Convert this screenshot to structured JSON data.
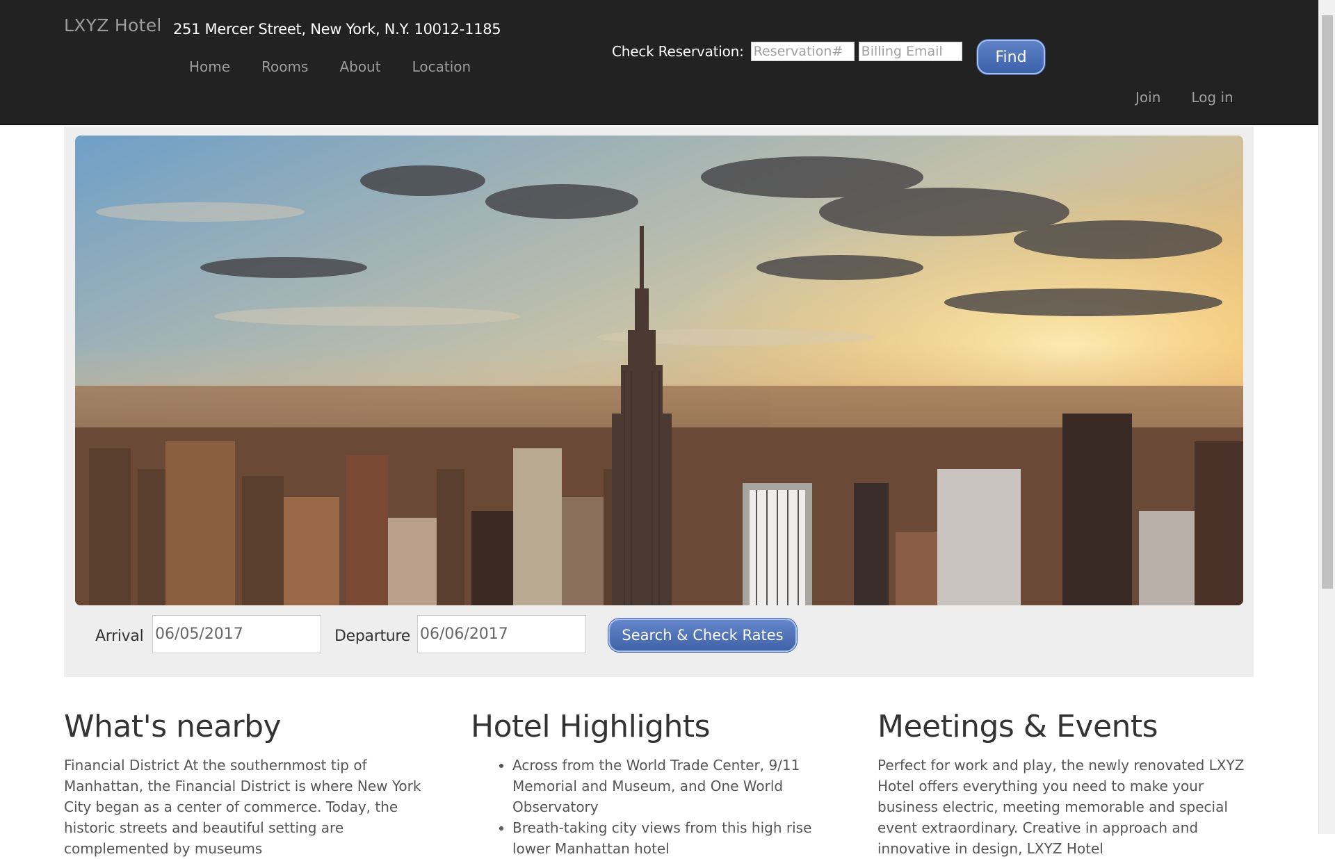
{
  "navbar": {
    "brand": "LXYZ Hotel",
    "address": "251 Mercer Street, New York, N.Y. 10012-1185",
    "links": [
      "Home",
      "Rooms",
      "About",
      "Location"
    ],
    "check_reservation": {
      "label": "Check Reservation:",
      "reservation_placeholder": "Reservation#",
      "email_placeholder": "Billing Email",
      "find_label": "Find"
    },
    "auth": {
      "join": "Join",
      "login": "Log in"
    }
  },
  "booking": {
    "arrival_label": "Arrival",
    "arrival_value": "06/05/2017",
    "departure_label": "Departure",
    "departure_value": "06/06/2017",
    "search_label": "Search & Check Rates"
  },
  "columns": {
    "nearby": {
      "title": "What's nearby",
      "text": "Financial District At the southernmost tip of Manhattan, the Financial District is where New York City began as a center of commerce. Today, the historic streets and beautiful setting are complemented by museums"
    },
    "highlights": {
      "title": "Hotel Highlights",
      "items": [
        "Across from the World Trade Center, 9/11 Memorial and Museum, and One World Observatory",
        "Breath-taking city views from this high rise lower Manhattan hotel"
      ]
    },
    "meetings": {
      "title": "Meetings & Events",
      "text": "Perfect for work and play, the newly renovated LXYZ Hotel offers everything you need to make your business electric, meeting memorable and special event extraordinary. Creative in approach and innovative in design, LXYZ Hotel"
    }
  },
  "colors": {
    "navbar_bg": "#222222",
    "nav_link": "#9d9d9d",
    "button_blue": "#4a6db5",
    "jumbotron_bg": "#eeeeee"
  },
  "hero_image": "new-york-skyline-sunset"
}
